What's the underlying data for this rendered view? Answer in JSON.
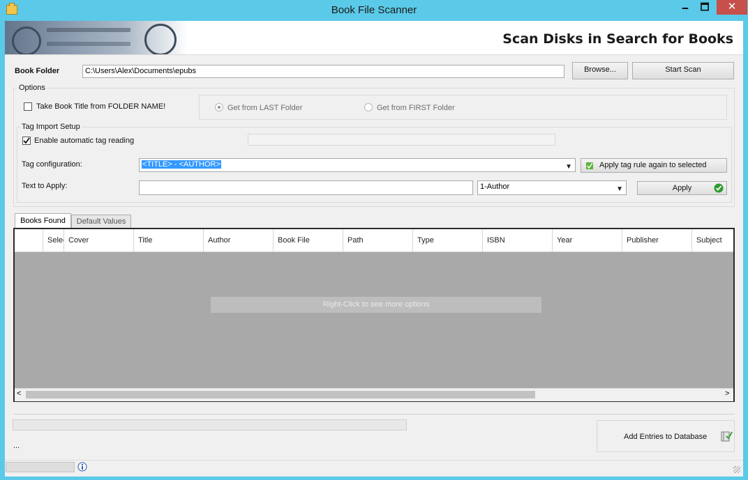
{
  "window": {
    "title": "Book File Scanner",
    "minimize": "🗕",
    "maximize": "🗖",
    "close": "✕"
  },
  "banner": {
    "heading": "Scan Disks in Search for Books"
  },
  "folder": {
    "label": "Book Folder",
    "value": "C:\\Users\\Alex\\Documents\\epubs",
    "browse_label": "Browse...",
    "start_label": "Start Scan"
  },
  "options": {
    "title": "Options",
    "folder_name_label": "Take Book Title from FOLDER NAME!",
    "folder_name_checked": false,
    "last_folder_label": "Get from LAST Folder",
    "first_folder_label": "Get from FIRST Folder"
  },
  "tag_setup": {
    "title": "Tag Import Setup",
    "enable_label": "Enable automatic tag reading",
    "enable_checked": true,
    "config_label": "Tag configuration:",
    "config_value": "<TITLE> - <AUTHOR>",
    "reapply_label": "Apply tag rule again to selected",
    "text_label": "Text to Apply:",
    "text_value": "",
    "field_value": "1-Author",
    "apply_label": "Apply"
  },
  "tabs": [
    {
      "label": "Books Found",
      "active": true
    },
    {
      "label": "Default Values",
      "active": false
    }
  ],
  "grid": {
    "columns": [
      "Select",
      "Cover",
      "Title",
      "Author",
      "Book File",
      "Path",
      "Type",
      "ISBN",
      "Year",
      "Publisher",
      "Subject"
    ],
    "hint": "Right-Click to see more options",
    "scroll_left": "<",
    "scroll_right": ">"
  },
  "footer": {
    "ellipsis": "...",
    "add_label": "Add Entries to Database"
  },
  "icons": {
    "info": "info-icon",
    "add": "add-to-database-icon",
    "apply_ok": "check-icon",
    "reapply": "apply-tag-icon",
    "app": "folder-icon"
  },
  "colors": {
    "titlebar": "#5bc9e8",
    "close": "#c7504b",
    "selection": "#3399ff"
  }
}
